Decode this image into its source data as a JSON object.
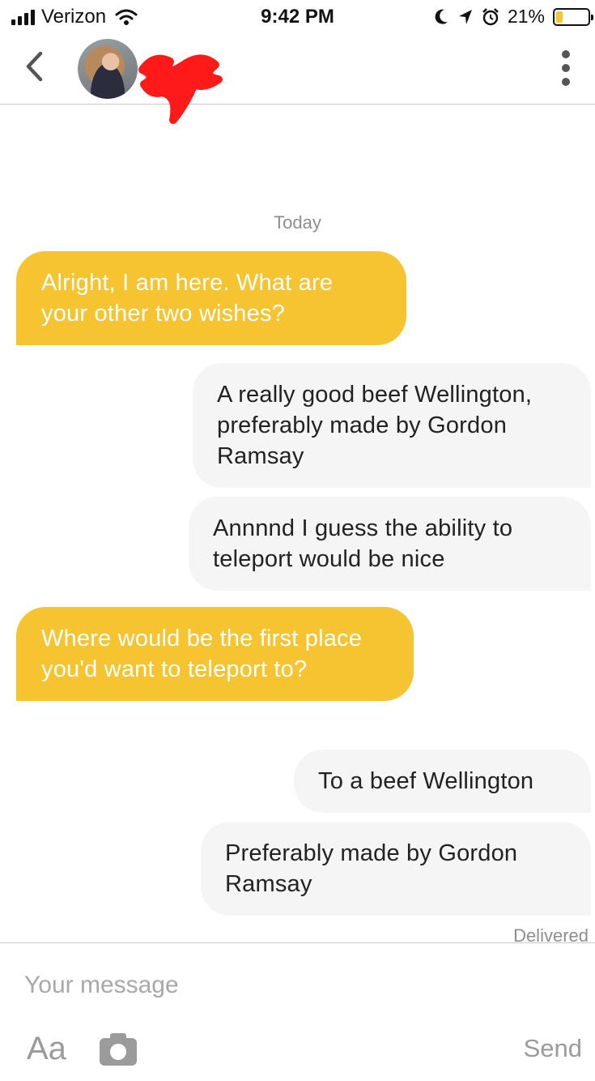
{
  "status_bar": {
    "carrier": "Verizon",
    "time": "9:42 PM",
    "battery_percent_label": "21%",
    "battery_level": 0.21,
    "battery_color": "#f6c431"
  },
  "header": {
    "back_icon": "chevron-left-icon",
    "menu_icon": "more-vertical-icon"
  },
  "conversation": {
    "date_label": "Today",
    "messages": [
      {
        "direction": "in",
        "text": "Alright, I am here. What are your other two wishes?"
      },
      {
        "direction": "out",
        "text": "A really good beef Wellington, preferably made by Gordon Ramsay"
      },
      {
        "direction": "out",
        "text": "Annnnd I guess the ability to teleport would be nice"
      },
      {
        "direction": "in",
        "text": "Where would be the first place you'd want to teleport to?"
      },
      {
        "direction": "out",
        "text": "To a beef Wellington"
      },
      {
        "direction": "out",
        "text": "Preferably made by Gordon Ramsay"
      }
    ],
    "delivery_status": "Delivered"
  },
  "composer": {
    "placeholder": "Your message",
    "format_label": "Aa",
    "camera_icon": "camera-icon",
    "send_label": "Send"
  },
  "colors": {
    "incoming_bubble": "#f6c431",
    "outgoing_bubble": "#f5f5f5"
  }
}
